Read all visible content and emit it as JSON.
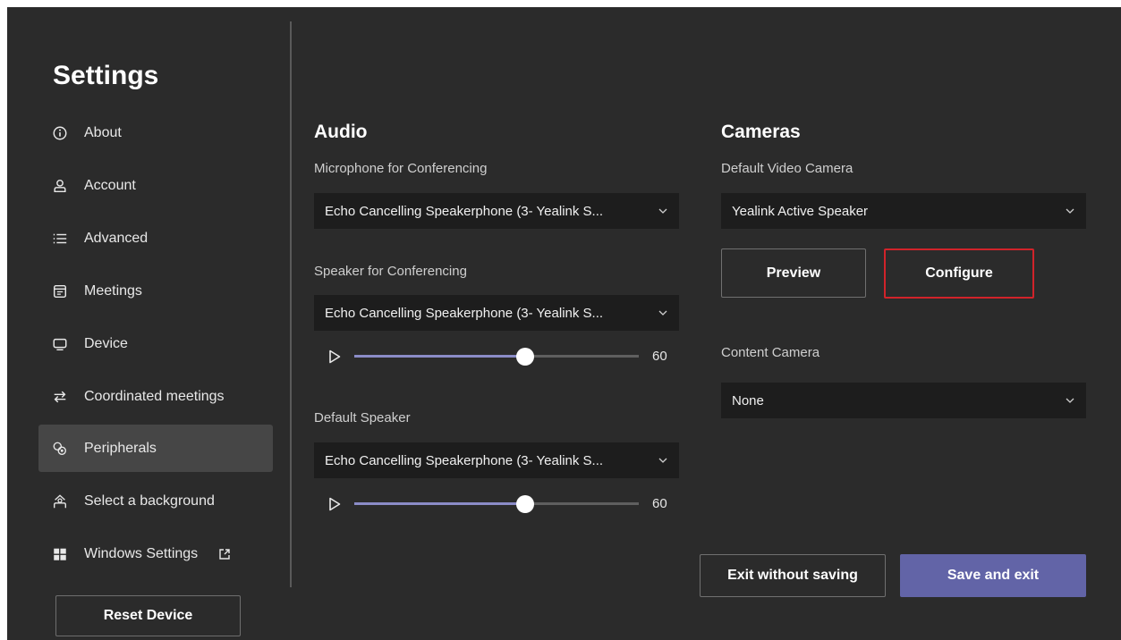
{
  "sidebar": {
    "title": "Settings",
    "items": [
      {
        "label": "About",
        "icon": "info-icon"
      },
      {
        "label": "Account",
        "icon": "person-icon"
      },
      {
        "label": "Advanced",
        "icon": "list-icon"
      },
      {
        "label": "Meetings",
        "icon": "calendar-icon"
      },
      {
        "label": "Device",
        "icon": "monitor-icon"
      },
      {
        "label": "Coordinated meetings",
        "icon": "swap-arrows-icon"
      },
      {
        "label": "Peripherals",
        "icon": "peripherals-icon",
        "active": true
      },
      {
        "label": "Select a background",
        "icon": "background-icon"
      },
      {
        "label": "Windows Settings",
        "icon": "windows-icon",
        "external_icon": "external-link-icon"
      }
    ],
    "reset_label": "Reset Device"
  },
  "audio": {
    "heading": "Audio",
    "microphone": {
      "label": "Microphone for Conferencing",
      "value": "Echo Cancelling Speakerphone (3- Yealink S..."
    },
    "speaker": {
      "label": "Speaker for Conferencing",
      "value": "Echo Cancelling Speakerphone (3- Yealink S...",
      "volume": 60,
      "volume_max": 100
    },
    "default_speaker": {
      "label": "Default Speaker",
      "value": "Echo Cancelling Speakerphone (3- Yealink S...",
      "volume": 60,
      "volume_max": 100
    }
  },
  "cameras": {
    "heading": "Cameras",
    "default_video": {
      "label": "Default Video Camera",
      "value": "Yealink Active Speaker"
    },
    "preview_label": "Preview",
    "configure_label": "Configure",
    "content_camera": {
      "label": "Content Camera",
      "value": "None"
    }
  },
  "footer": {
    "exit_without_saving_label": "Exit without saving",
    "save_and_exit_label": "Save and exit"
  },
  "colors": {
    "background": "#2b2b2b",
    "sidebar_active": "#464646",
    "accent": "#6264a7",
    "slider_fill": "#8b8cc7",
    "highlight_border": "#d1232a",
    "dropdown_bg": "#1d1d1d"
  }
}
